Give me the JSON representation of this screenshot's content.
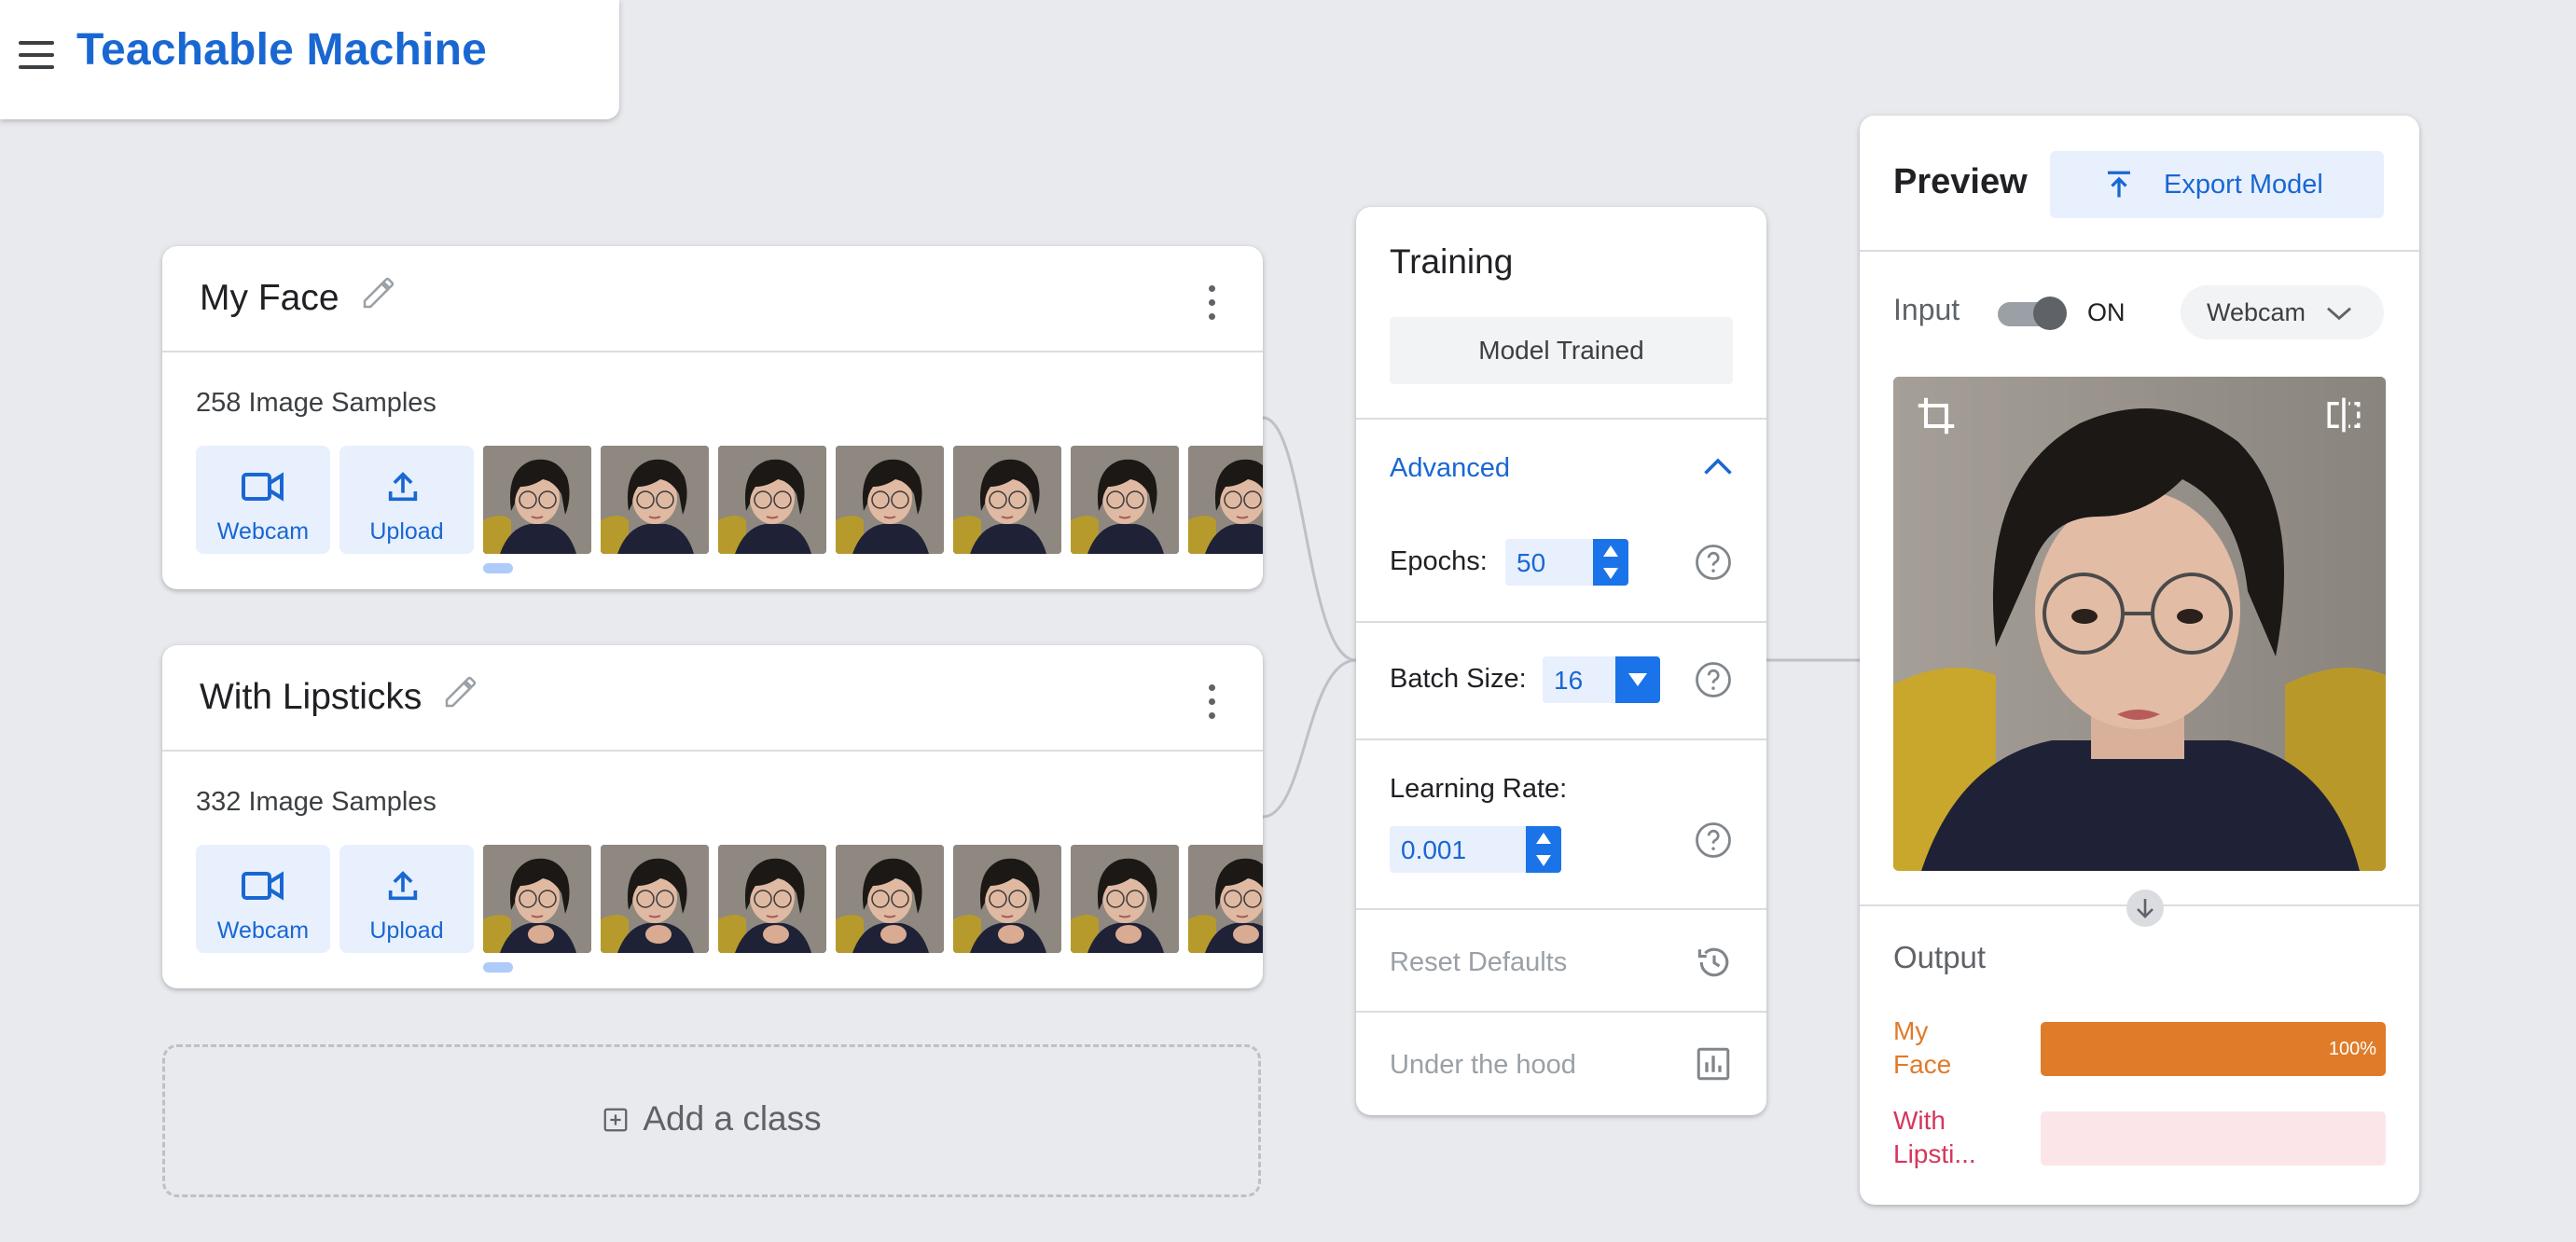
{
  "app": {
    "title": "Teachable Machine"
  },
  "classes": [
    {
      "name": "My Face",
      "samples_text": "258 Image Samples",
      "webcam_label": "Webcam",
      "upload_label": "Upload"
    },
    {
      "name": "With Lipsticks",
      "samples_text": "332 Image Samples",
      "webcam_label": "Webcam",
      "upload_label": "Upload"
    }
  ],
  "add_class": {
    "label": "Add a class"
  },
  "training": {
    "title": "Training",
    "status_button": "Model Trained",
    "advanced_label": "Advanced",
    "epochs_label": "Epochs:",
    "epochs_value": "50",
    "batch_label": "Batch Size:",
    "batch_value": "16",
    "lr_label": "Learning Rate:",
    "lr_value": "0.001",
    "reset_label": "Reset Defaults",
    "hood_label": "Under the hood"
  },
  "preview": {
    "title": "Preview",
    "export_label": "Export Model",
    "input_label": "Input",
    "toggle_state": "ON",
    "source": "Webcam",
    "output_label": "Output",
    "outputs": [
      {
        "line1": "My",
        "line2": "Face",
        "percent_text": "100%",
        "fraction": 1.0,
        "color": "#e07b2a",
        "bg": "#fbe3cf"
      },
      {
        "line1": "With",
        "line2": "Lipsti...",
        "percent_text": "",
        "fraction": 0.0,
        "color": "#d5365d",
        "bg": "#fce5e8"
      }
    ]
  },
  "colors": {
    "accent": "#1a73e8",
    "brand_text": "#1967d2"
  }
}
